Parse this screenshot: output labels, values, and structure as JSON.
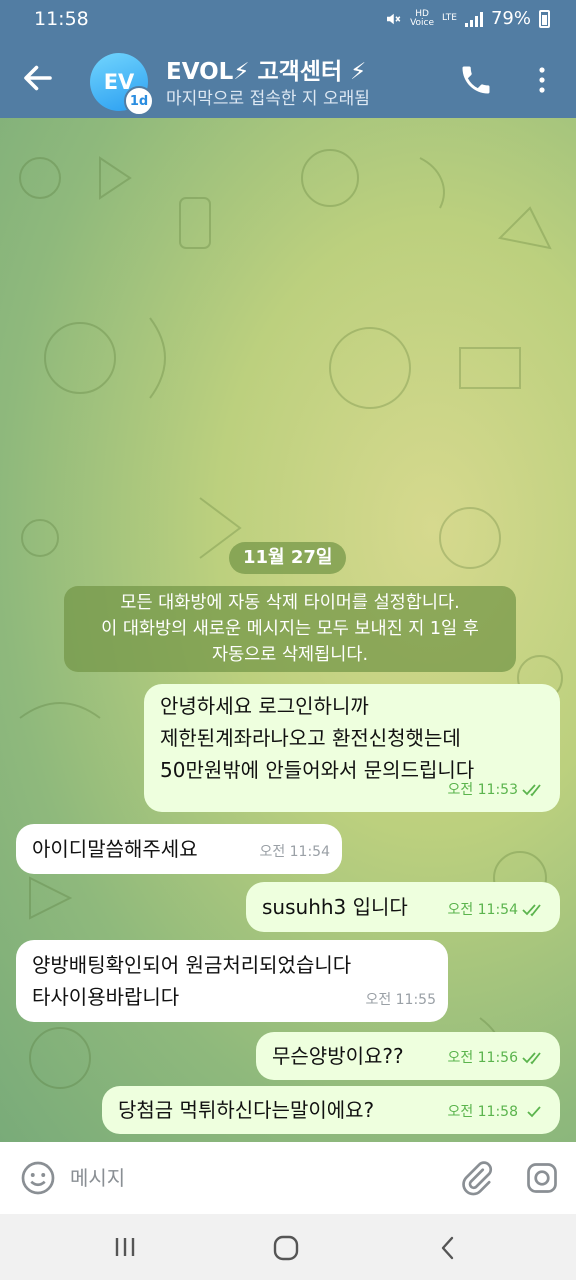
{
  "status_bar": {
    "time": "11:58",
    "hd_label": "HD",
    "voice_label": "Voice",
    "network": "LTE",
    "battery": "79%"
  },
  "header": {
    "avatar_initials": "EV",
    "avatar_badge": "1d",
    "title": "EVOL⚡ 고객센터 ⚡",
    "subtitle": "마지막으로 접속한 지 오래됨"
  },
  "chat": {
    "date": "11월 27일",
    "service_message": "모든 대화방에 자동 삭제 타이머를 설정합니다.\n이 대화방의 새로운 메시지는 모두 보내진 지 1일 후\n자동으로 삭제됩니다.",
    "messages": [
      {
        "direction": "outgoing",
        "text": "안녕하세요 로그인하니까\n제한된계좌라나오고 환전신청햇는데\n50만원밖에 안들어와서 문의드립니다",
        "time": "오전 11:53",
        "status": "read"
      },
      {
        "direction": "incoming",
        "text": "아이디말씀해주세요",
        "time": "오전 11:54"
      },
      {
        "direction": "outgoing",
        "text": "susuhh3 입니다",
        "time": "오전 11:54",
        "status": "read"
      },
      {
        "direction": "incoming",
        "text": "양방배팅확인되어 원금처리되었습니다\n타사이용바랍니다",
        "time": "오전 11:55"
      },
      {
        "direction": "outgoing",
        "text": "무슨양방이요??",
        "time": "오전 11:56",
        "status": "read"
      },
      {
        "direction": "outgoing",
        "text": "당첨금 먹튀하신다는말이에요?",
        "time": "오전 11:58",
        "status": "sent"
      }
    ]
  },
  "input_bar": {
    "placeholder": "메시지"
  },
  "colors": {
    "header_bg": "#527da3",
    "outgoing_bubble": "#eeffde",
    "incoming_bubble": "#ffffff",
    "check_color": "#5bb44d"
  },
  "icons": [
    "back-arrow-icon",
    "phone-icon",
    "more-vert-icon",
    "emoji-icon",
    "attach-icon",
    "camera-icon",
    "double-check-icon",
    "single-check-icon"
  ]
}
